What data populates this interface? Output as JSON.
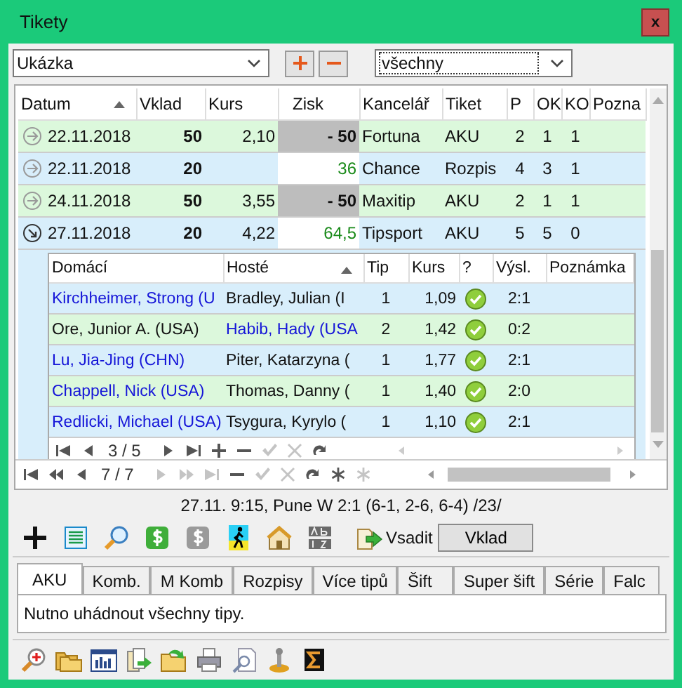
{
  "window": {
    "title": "Tikety",
    "close": "x"
  },
  "toolbar": {
    "set": "Ukázka",
    "filter": "všechny"
  },
  "tickets": {
    "columns": [
      {
        "label": "Datum",
        "sorted": true
      },
      {
        "label": "Vklad",
        "sorted": false
      },
      {
        "label": "Kurs",
        "sorted": false
      },
      {
        "label": "Zisk",
        "sorted": false
      },
      {
        "label": "Kancelář",
        "sorted": false
      },
      {
        "label": "Tiket",
        "sorted": false
      },
      {
        "label": "P",
        "sorted": false
      },
      {
        "label": "OK",
        "sorted": false
      },
      {
        "label": "KO",
        "sorted": false
      },
      {
        "label": "Pozna",
        "sorted": false
      }
    ],
    "rows": [
      {
        "expanded": false,
        "date": "22.11.2018",
        "stake": "50",
        "odds": "2,10",
        "profit": "- 50",
        "won": false,
        "bookmaker": "Fortuna",
        "type": "AKU",
        "p": "2",
        "ok": "1",
        "ko": "1"
      },
      {
        "expanded": false,
        "date": "22.11.2018",
        "stake": "20",
        "odds": "",
        "profit": "36",
        "won": true,
        "bookmaker": "Chance",
        "type": "Rozpis",
        "p": "4",
        "ok": "3",
        "ko": "1"
      },
      {
        "expanded": false,
        "date": "24.11.2018",
        "stake": "50",
        "odds": "3,55",
        "profit": "- 50",
        "won": false,
        "bookmaker": "Maxitip",
        "type": "AKU",
        "p": "2",
        "ok": "1",
        "ko": "1"
      },
      {
        "expanded": true,
        "date": "27.11.2018",
        "stake": "20",
        "odds": "4,22",
        "profit": "64,5",
        "won": true,
        "bookmaker": "Tipsport",
        "type": "AKU",
        "p": "5",
        "ok": "5",
        "ko": "0"
      }
    ],
    "nav": {
      "position": "7 / 7",
      "buttons": [
        {
          "kind": "first",
          "disabled": false
        },
        {
          "kind": "prev-page",
          "disabled": false
        },
        {
          "kind": "prev",
          "disabled": false
        },
        {
          "kind": "pos"
        },
        {
          "kind": "next",
          "disabled": true
        },
        {
          "kind": "next-page",
          "disabled": true
        },
        {
          "kind": "last",
          "disabled": true
        },
        {
          "kind": "remove",
          "disabled": false
        },
        {
          "kind": "confirm",
          "disabled": true
        },
        {
          "kind": "cancel",
          "disabled": true
        },
        {
          "kind": "refresh",
          "disabled": false
        },
        {
          "kind": "asterisk",
          "disabled": false
        },
        {
          "kind": "asterisk",
          "disabled": true
        }
      ]
    }
  },
  "matches": {
    "columns": [
      {
        "label": "Domácí",
        "sorted": false
      },
      {
        "label": "Hosté",
        "sorted": true
      },
      {
        "label": "Tip",
        "sorted": false
      },
      {
        "label": "Kurs",
        "sorted": false
      },
      {
        "label": "?",
        "sorted": false
      },
      {
        "label": "Výsl.",
        "sorted": false
      },
      {
        "label": "Poznámka",
        "sorted": false
      }
    ],
    "rows": [
      {
        "home": "Kirchheimer, Strong (U",
        "away": "Bradley, Julian (I",
        "home_highlighted": true,
        "away_highlighted": false,
        "tip": "1",
        "odds": "1,09",
        "ok": true,
        "score": "2:1"
      },
      {
        "home": "Ore, Junior A. (USA)",
        "away": "Habib, Hady (USA",
        "home_highlighted": false,
        "away_highlighted": true,
        "tip": "2",
        "odds": "1,42",
        "ok": true,
        "score": "0:2"
      },
      {
        "home": "Lu, Jia-Jing (CHN)",
        "away": "Piter, Katarzyna (",
        "home_highlighted": true,
        "away_highlighted": false,
        "tip": "1",
        "odds": "1,77",
        "ok": true,
        "score": "2:1"
      },
      {
        "home": "Chappell, Nick (USA)",
        "away": "Thomas, Danny (",
        "home_highlighted": true,
        "away_highlighted": false,
        "tip": "1",
        "odds": "1,40",
        "ok": true,
        "score": "2:0"
      },
      {
        "home": "Redlicki, Michael (USA)",
        "away": "Tsygura, Kyrylo (",
        "home_highlighted": true,
        "away_highlighted": false,
        "tip": "1",
        "odds": "1,10",
        "ok": true,
        "score": "2:1"
      }
    ],
    "nav": {
      "position": "3 / 5",
      "buttons": [
        {
          "kind": "first",
          "disabled": false
        },
        {
          "kind": "prev",
          "disabled": false
        },
        {
          "kind": "pos"
        },
        {
          "kind": "next",
          "disabled": false
        },
        {
          "kind": "last",
          "disabled": false
        },
        {
          "kind": "add",
          "disabled": false
        },
        {
          "kind": "remove",
          "disabled": false
        },
        {
          "kind": "confirm",
          "disabled": true
        },
        {
          "kind": "cancel",
          "disabled": true
        },
        {
          "kind": "refresh",
          "disabled": false
        }
      ]
    }
  },
  "info": "27.11. 9:15, Pune W 2:1 (6-1, 2-6, 6-4) /23/",
  "actions": {
    "bet": "Vsadit",
    "stake": "Vklad"
  },
  "tabs": [
    {
      "label": "AKU",
      "selected": true
    },
    {
      "label": "Komb.",
      "selected": false
    },
    {
      "label": "M Komb",
      "selected": false
    },
    {
      "label": "Rozpisy",
      "selected": false
    },
    {
      "label": "Více tipů",
      "selected": false
    },
    {
      "label": "Šift",
      "selected": false
    },
    {
      "label": "Super šift",
      "selected": false
    },
    {
      "label": "Série",
      "selected": false
    },
    {
      "label": "Falc",
      "selected": false
    }
  ],
  "tab_content": "Nutno uhádnout všechny tipy."
}
